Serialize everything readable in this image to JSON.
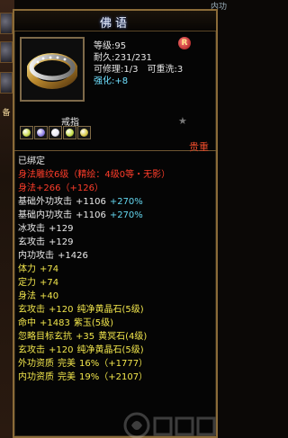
{
  "background": {
    "left_label": "备",
    "right_label": "内功"
  },
  "item": {
    "title": "佛语",
    "level_label": "等级:",
    "level_value": "95",
    "durability_label": "耐久:",
    "durability_value": "231/231",
    "repair_label": "可修理:",
    "repair_value": "1/3",
    "rewash_label": "可重洗:",
    "rewash_value": "3",
    "enhance_label": "强化:",
    "enhance_value": "+8",
    "badge_letter": "R",
    "category": "戒指",
    "rarity": "贵重",
    "gem_colors": [
      "#c9d94a",
      "#8d7fe8",
      "#e8e8f5",
      "#c5df45",
      "#d9c845"
    ]
  },
  "properties": [
    {
      "color": "white",
      "parts": [
        "已绑定"
      ]
    },
    {
      "color": "red",
      "parts": [
        "身法雕纹6级（精绘：4级0等・无影）"
      ]
    },
    {
      "color": "red",
      "parts": [
        "身法+266（+126）"
      ]
    },
    {
      "color": "white",
      "parts": [
        "基础外功攻击",
        "+1106",
        "+270%"
      ]
    },
    {
      "color": "white",
      "parts": [
        "基础内功攻击",
        "+1106",
        "+270%"
      ]
    },
    {
      "color": "white",
      "parts": [
        "冰攻击",
        "+129"
      ]
    },
    {
      "color": "white",
      "parts": [
        "玄攻击",
        "+129"
      ]
    },
    {
      "color": "white",
      "parts": [
        "内功攻击",
        "+1426"
      ]
    },
    {
      "color": "yellow",
      "parts": [
        "体力",
        "+74"
      ]
    },
    {
      "color": "yellow",
      "parts": [
        "定力",
        "+74"
      ]
    },
    {
      "color": "yellow",
      "parts": [
        "身法",
        "+40"
      ]
    },
    {
      "color": "yellow",
      "parts": [
        "玄攻击",
        "+120",
        "纯净黄晶石(5级)"
      ]
    },
    {
      "color": "yellow",
      "parts": [
        "命中",
        "+1483",
        "紫玉(5级)"
      ]
    },
    {
      "color": "yellow",
      "parts": [
        "忽略目标玄抗",
        "+35",
        "黄冥石(4级)"
      ]
    },
    {
      "color": "yellow",
      "parts": [
        "玄攻击",
        "+120",
        "纯净黄晶石(5级)"
      ]
    },
    {
      "color": "yellow",
      "parts": [
        "外功资质",
        "完美",
        "16%（+1777）"
      ]
    },
    {
      "color": "yellow",
      "parts": [
        "内功资质",
        "完美",
        "19%（+2107）"
      ]
    }
  ]
}
